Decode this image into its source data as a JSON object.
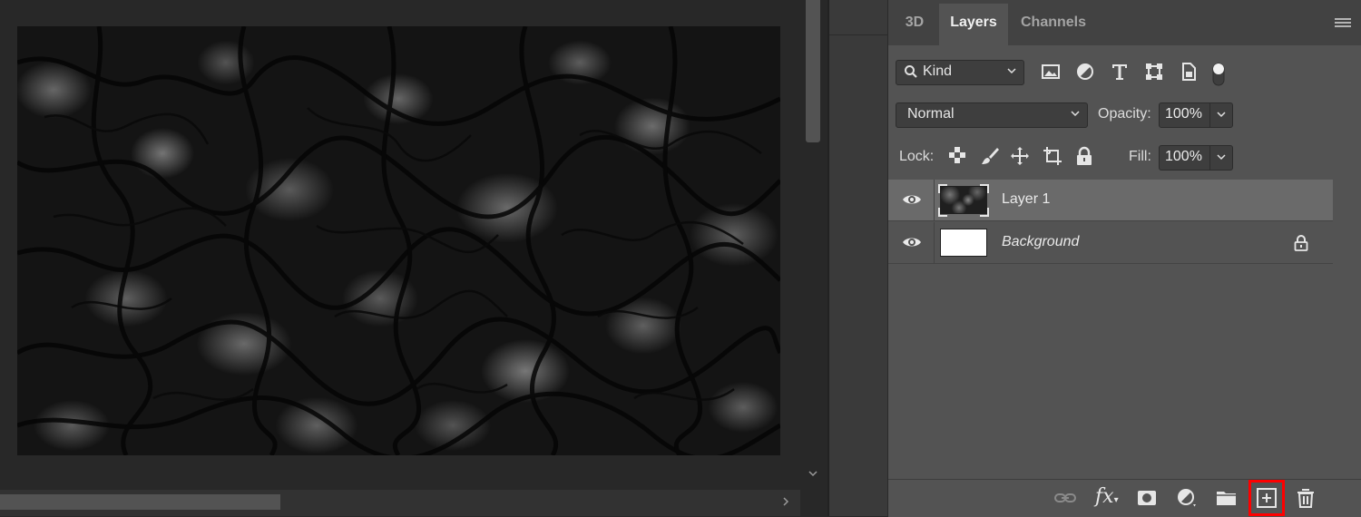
{
  "panel": {
    "tabs": [
      {
        "label": "3D",
        "active": false
      },
      {
        "label": "Layers",
        "active": true
      },
      {
        "label": "Channels",
        "active": false
      }
    ],
    "menu_icon": "hamburger-menu-icon"
  },
  "filter": {
    "kind_label": "Kind",
    "filter_icons": [
      "pixel-layer-filter-icon",
      "adjustment-layer-filter-icon",
      "type-layer-filter-icon",
      "shape-layer-filter-icon",
      "smart-object-filter-icon",
      "filter-toggle-icon"
    ]
  },
  "blend": {
    "mode": "Normal",
    "opacity_label": "Opacity:",
    "opacity_value": "100%"
  },
  "lock": {
    "label": "Lock:",
    "icons": [
      "lock-transparent-pixels-icon",
      "lock-image-pixels-icon",
      "lock-position-icon",
      "prevent-autonest-icon",
      "lock-all-icon"
    ],
    "fill_label": "Fill:",
    "fill_value": "100%"
  },
  "layers": [
    {
      "name": "Layer 1",
      "visible": true,
      "selected": true,
      "thumbnail": "noise-texture",
      "locked": false
    },
    {
      "name": "Background",
      "visible": true,
      "selected": false,
      "thumbnail": "white",
      "locked": true
    }
  ],
  "footer": {
    "buttons": [
      "link-layers-icon",
      "layer-style-fx-icon",
      "add-mask-icon",
      "adjustment-layer-icon",
      "new-group-folder-icon",
      "new-layer-icon",
      "delete-layer-icon"
    ],
    "fx_label": "fx",
    "highlighted": "new-layer-icon",
    "highlight_color": "#ff0000"
  },
  "colors": {
    "panel_bg": "#535353",
    "selected_row": "#6a6a6a",
    "canvas_bg": "#282828"
  }
}
